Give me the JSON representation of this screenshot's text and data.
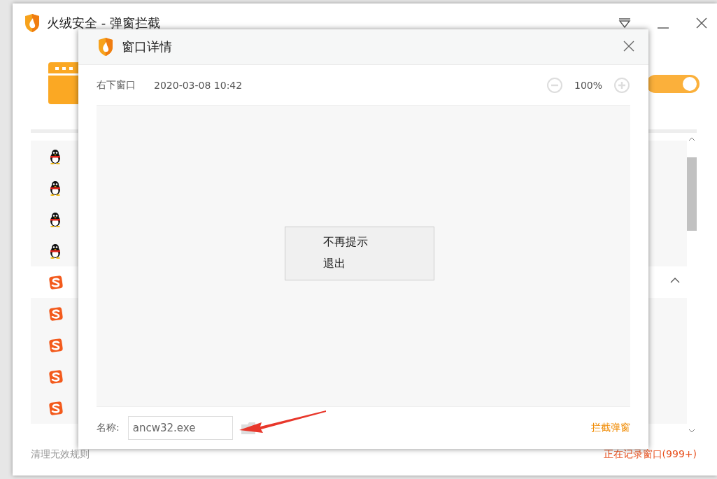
{
  "main_window": {
    "title": "火绒安全 - 弹窗拦截",
    "toggle": {
      "on": true
    },
    "rules": [
      {
        "kind": "qq-item"
      },
      {
        "kind": "qq-item"
      },
      {
        "kind": "qq-item"
      },
      {
        "kind": "qq-item"
      },
      {
        "kind": "sogou-group",
        "expanded": true
      },
      {
        "kind": "sogou-item"
      },
      {
        "kind": "sogou-item"
      },
      {
        "kind": "sogou-item"
      },
      {
        "kind": "sogou-item"
      }
    ],
    "clean_link": "清理无效规则",
    "status": "正在记录窗口(999+)"
  },
  "dialog": {
    "title": "窗口详情",
    "source": "右下窗口",
    "time": "2020-03-08 10:42",
    "zoom": "100%",
    "preview_menu": [
      "不再提示",
      "退出"
    ],
    "name_label": "名称:",
    "name_value": "ancw32.exe",
    "block_link": "拦截弹窗"
  }
}
